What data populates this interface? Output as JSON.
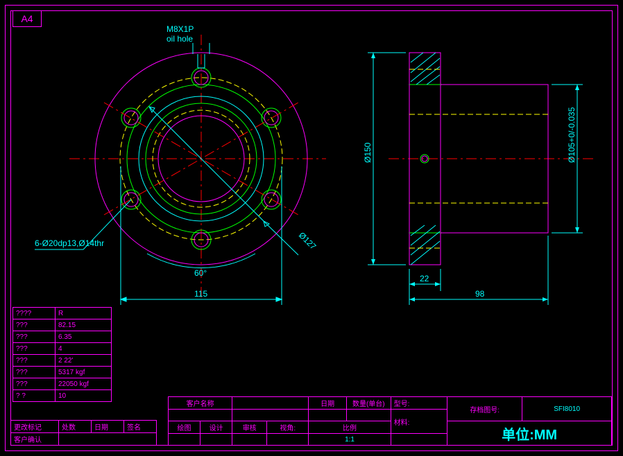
{
  "sheet": {
    "size": "A4"
  },
  "annotations": {
    "oil_hole_line1": "M8X1P",
    "oil_hole_line2": "oil hole",
    "bolt_pattern": "6-Ø20dp13,Ø14thr",
    "angle": "60°",
    "bolt_circle_dim": "115",
    "diameter_127": "Ø127",
    "diameter_150": "Ø150",
    "diameter_105": "Ø105+0/-0.035",
    "flange_thk": "22",
    "total_length": "98"
  },
  "spec_table": {
    "rows": [
      [
        "????",
        "R"
      ],
      [
        "???",
        "82.15"
      ],
      [
        "???",
        "6.35"
      ],
      [
        "???",
        "4"
      ],
      [
        "???",
        "2 22'"
      ],
      [
        "???",
        "5317 kgf"
      ],
      [
        "???",
        "22050 kgf"
      ],
      [
        "? ?",
        "10"
      ]
    ]
  },
  "revision": {
    "h1": "更改标记",
    "h2": "处数",
    "h3": "日期",
    "h4": "签名",
    "row2": "客户确认"
  },
  "title_block": {
    "customer": "客户名称",
    "date": "日期",
    "qty": "数量(单台)",
    "model": "型号:",
    "dwg_no_label": "存档图号:",
    "dwg_no": "SFI8010",
    "draw": "绘图",
    "design": "设计",
    "check": "审核",
    "view": "视角:",
    "scale": "比例",
    "scale_val": "1:1",
    "material": "材料:",
    "unit": "单位:MM"
  }
}
